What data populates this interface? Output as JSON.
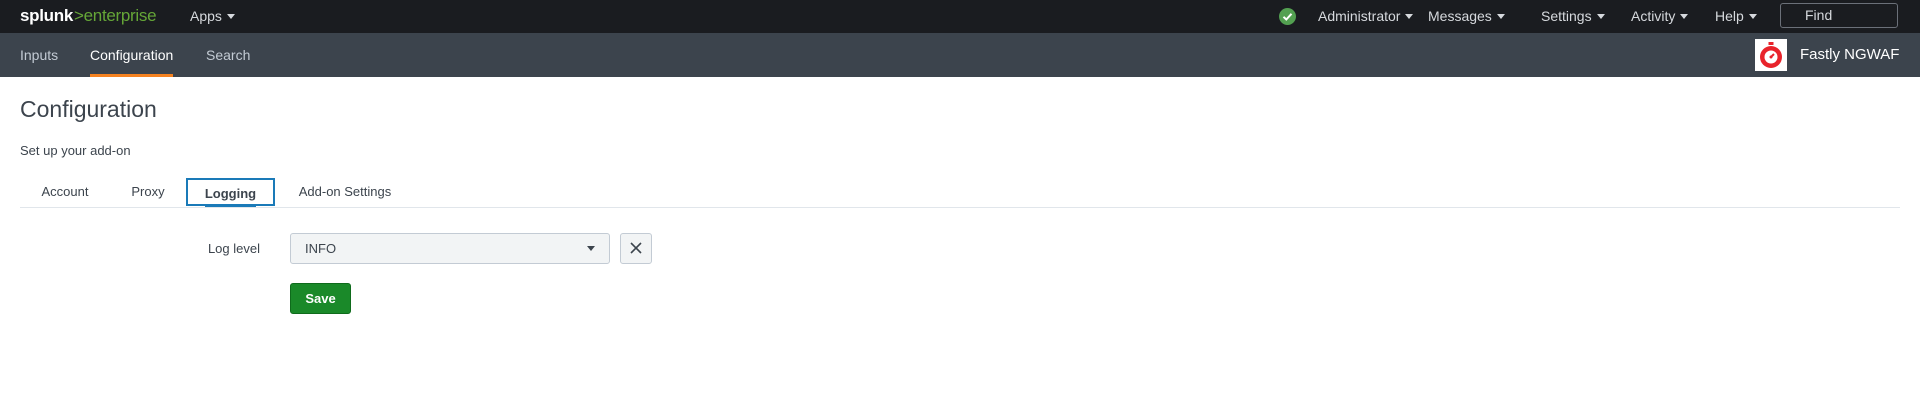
{
  "header": {
    "logo_brand": "splunk",
    "logo_sep": ">",
    "logo_product": "enterprise",
    "apps_label": "Apps",
    "health_icon": "check-circle-icon",
    "menus": [
      "Administrator",
      "Messages",
      "Settings",
      "Activity",
      "Help"
    ],
    "find_placeholder": "Find"
  },
  "appbar": {
    "tabs": [
      "Inputs",
      "Configuration",
      "Search"
    ],
    "active_tab": "Configuration",
    "app_name": "Fastly NGWAF",
    "app_logo_icon": "stopwatch-icon"
  },
  "page": {
    "title": "Configuration",
    "description": "Set up your add-on",
    "tabs": [
      "Account",
      "Proxy",
      "Logging",
      "Add-on Settings"
    ],
    "active_tab": "Logging"
  },
  "form": {
    "log_level_label": "Log level",
    "log_level_value": "INFO",
    "clear_icon": "close-icon",
    "save_label": "Save"
  },
  "colors": {
    "topbar": "#1a1c20",
    "appbar": "#3c444d",
    "accent_orange": "#f58220",
    "save_green": "#1a8929",
    "active_tab_border": "#1a7ab8",
    "health_green": "#53a051",
    "logo_red": "#e8232b"
  }
}
